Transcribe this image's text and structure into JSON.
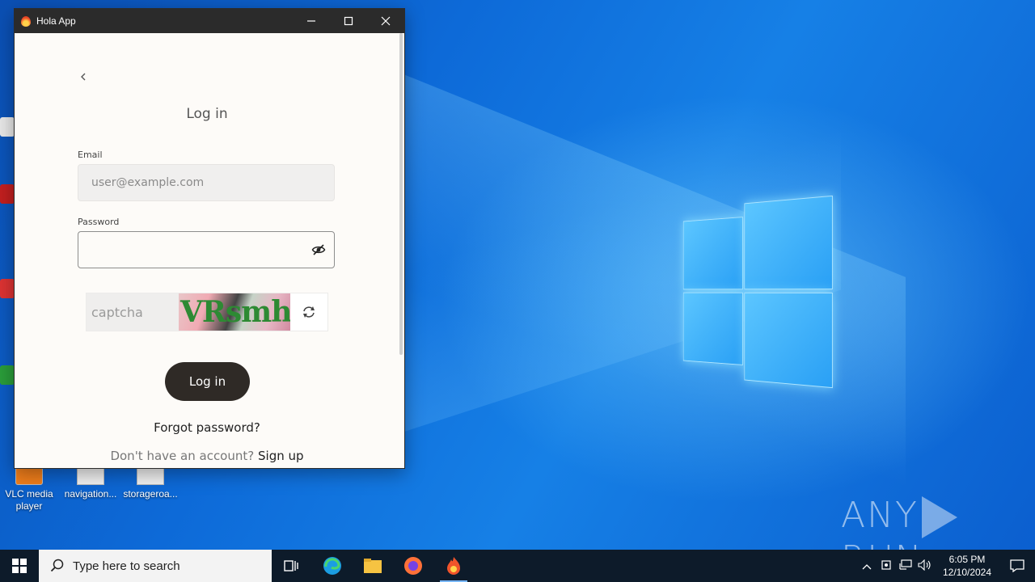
{
  "window": {
    "title": "Hola App"
  },
  "login": {
    "title": "Log in",
    "email_label": "Email",
    "email_placeholder": "user@example.com",
    "password_label": "Password",
    "captcha_placeholder": "captcha",
    "captcha_image_text": "VRsmh",
    "login_button": "Log in",
    "forgot_password": "Forgot password?",
    "no_account_text": "Don't have an account?",
    "signup_link": "Sign up"
  },
  "desktop": {
    "icons": [
      {
        "label": "VLC media player",
        "icon": "vlc-icon"
      },
      {
        "label": "navigation...",
        "icon": "file-icon"
      },
      {
        "label": "storageroa...",
        "icon": "file-icon"
      }
    ],
    "watermark": {
      "left": "ANY",
      "right": "RUN"
    }
  },
  "taskbar": {
    "search_placeholder": "Type here to search",
    "time": "6:05 PM",
    "date": "12/10/2024"
  },
  "colors": {
    "primary_button": "#2f2a26",
    "window_bg": "#fdfbf8",
    "titlebar": "#2b2b2b",
    "taskbar": "#0d1b2a",
    "desktop_blue": "#0d6ad8"
  }
}
